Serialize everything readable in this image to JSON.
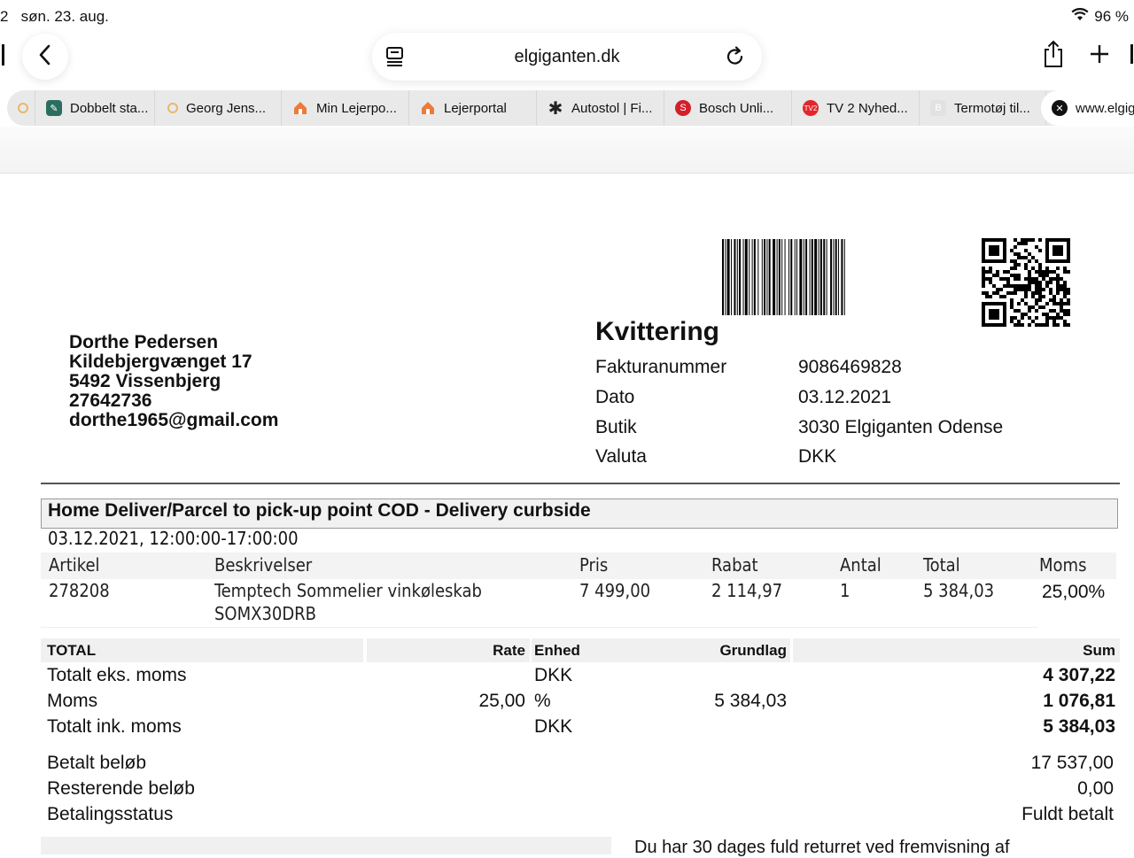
{
  "status": {
    "time_fragment": "2",
    "date": "søn. 23. aug.",
    "battery": "96 %"
  },
  "browser": {
    "url": "elgiganten.dk",
    "tabs": [
      {
        "label": "",
        "favicon": "circle-icon",
        "color": "#e8b86a"
      },
      {
        "label": "Dobbelt sta...",
        "favicon": "edit-icon",
        "color": "#2b6e60"
      },
      {
        "label": "Georg Jens...",
        "favicon": "circle-icon",
        "color": "#e8b86a"
      },
      {
        "label": "Min Lejerpo...",
        "favicon": "house-icon",
        "color": "#ee7a3a"
      },
      {
        "label": "Lejerportal",
        "favicon": "house-icon",
        "color": "#ee7a3a"
      },
      {
        "label": "Autostol | Fi...",
        "favicon": "asterisk-icon",
        "color": "#222222"
      },
      {
        "label": "Bosch Unli...",
        "favicon": "bosch-icon",
        "color": "#d2202a"
      },
      {
        "label": "TV 2 Nyhed...",
        "favicon": "tv2-icon",
        "color": "#e3262b"
      },
      {
        "label": "Termotøj til...",
        "favicon": "b-icon",
        "color": "#dddddd"
      },
      {
        "label": "www.elgiganten.dk",
        "favicon": "close-icon",
        "color": "#111111"
      }
    ]
  },
  "customer": {
    "name": "Dorthe Pedersen",
    "street": "Kildebjergvænget 17",
    "city": "5492 Vissenbjerg",
    "phone": "27642736",
    "email": "dorthe1965@gmail.com"
  },
  "receipt": {
    "title": "Kvittering",
    "meta": [
      {
        "label": "Fakturanummer",
        "value": "9086469828"
      },
      {
        "label": "Dato",
        "value": "03.12.2021"
      },
      {
        "label": "Butik",
        "value": "3030 Elgiganten Odense"
      },
      {
        "label": "Valuta",
        "value": "DKK"
      }
    ]
  },
  "delivery": {
    "title": "Home Deliver/Parcel to pick-up point COD - Delivery curbside",
    "time": "03.12.2021, 12:00:00-17:00:00"
  },
  "articles": {
    "headers": {
      "article": "Artikel",
      "description": "Beskrivelser",
      "price": "Pris",
      "discount": "Rabat",
      "qty": "Antal",
      "total": "Total",
      "vat": "Moms"
    },
    "rows": [
      {
        "article": "278208",
        "description_1": "Temptech Sommelier vinkøleskab",
        "description_2": "SOMX30DRB",
        "price": "7 499,00",
        "discount": "2 114,97",
        "qty": "1",
        "total": "5 384,03",
        "vat": "25,00%"
      }
    ]
  },
  "totals": {
    "headers": {
      "total": "TOTAL",
      "rate": "Rate",
      "unit": "Enhed",
      "basis": "Grundlag",
      "sum": "Sum"
    },
    "rows": [
      {
        "label": "Totalt eks. moms",
        "rate": "",
        "unit": "DKK",
        "basis": "",
        "sum": "4 307,22"
      },
      {
        "label": "Moms",
        "rate": "25,00",
        "unit": "%",
        "basis": "5 384,03",
        "sum": "1 076,81"
      },
      {
        "label": "Totalt ink. moms",
        "rate": "",
        "unit": "DKK",
        "basis": "",
        "sum": "5 384,03"
      }
    ]
  },
  "payment": [
    {
      "label": "Betalt beløb",
      "value": "17 537,00"
    },
    {
      "label": "Resterende beløb",
      "value": "0,00"
    },
    {
      "label": "Betalingsstatus",
      "value": "Fuldt betalt"
    }
  ],
  "footer_text": "Du har 30 dages fuld returret ved fremvisning af"
}
